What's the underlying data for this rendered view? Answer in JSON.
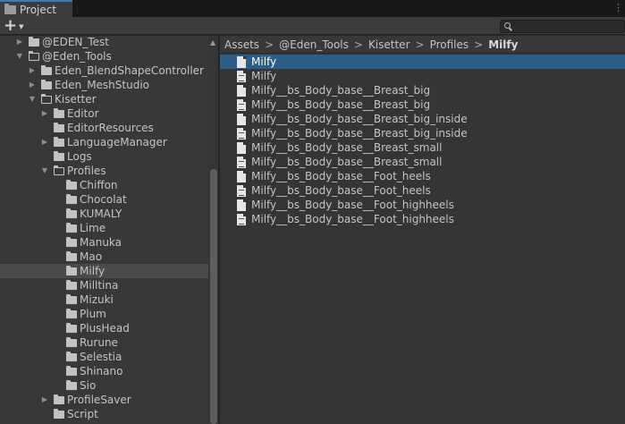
{
  "window": {
    "tab_label": "Project",
    "menu_glyph": "⋮"
  },
  "toolbar": {
    "add_glyph": "+",
    "add_caret": "▼"
  },
  "tree": {
    "rows": [
      {
        "label": "@EDEN_Test",
        "expanded": false,
        "has_children": true
      },
      {
        "label": "@Eden_Tools",
        "expanded": true,
        "has_children": true
      },
      {
        "label": "Eden_BlendShapeController",
        "expanded": false,
        "has_children": true
      },
      {
        "label": "Eden_MeshStudio",
        "expanded": false,
        "has_children": true
      },
      {
        "label": "Kisetter",
        "expanded": true,
        "has_children": true
      },
      {
        "label": "Editor",
        "expanded": false,
        "has_children": true
      },
      {
        "label": "EditorResources",
        "expanded": false,
        "has_children": false
      },
      {
        "label": "LanguageManager",
        "expanded": false,
        "has_children": true
      },
      {
        "label": "Logs",
        "expanded": false,
        "has_children": false
      },
      {
        "label": "Profiles",
        "expanded": true,
        "has_children": true
      },
      {
        "label": "Chiffon",
        "expanded": false,
        "has_children": false
      },
      {
        "label": "Chocolat",
        "expanded": false,
        "has_children": false
      },
      {
        "label": "KUMALY",
        "expanded": false,
        "has_children": false
      },
      {
        "label": "Lime",
        "expanded": false,
        "has_children": false
      },
      {
        "label": "Manuka",
        "expanded": false,
        "has_children": false
      },
      {
        "label": "Mao",
        "expanded": false,
        "has_children": false
      },
      {
        "label": "Milfy",
        "expanded": false,
        "has_children": false,
        "selected": true
      },
      {
        "label": "Milltina",
        "expanded": false,
        "has_children": false
      },
      {
        "label": "Mizuki",
        "expanded": false,
        "has_children": false
      },
      {
        "label": "Plum",
        "expanded": false,
        "has_children": false
      },
      {
        "label": "PlusHead",
        "expanded": false,
        "has_children": false
      },
      {
        "label": "Rurune",
        "expanded": false,
        "has_children": false
      },
      {
        "label": "Selestia",
        "expanded": false,
        "has_children": false
      },
      {
        "label": "Shinano",
        "expanded": false,
        "has_children": false
      },
      {
        "label": "Sio",
        "expanded": false,
        "has_children": false
      },
      {
        "label": "ProfileSaver",
        "expanded": false,
        "has_children": true
      },
      {
        "label": "Script",
        "expanded": false,
        "has_children": false
      }
    ]
  },
  "breadcrumb": {
    "items": [
      "Assets",
      "@Eden_Tools",
      "Kisetter",
      "Profiles",
      "Milfy"
    ],
    "separator": ">"
  },
  "files": [
    {
      "name": "Milfy",
      "icon": "file-icon",
      "selected": true
    },
    {
      "name": "Milfy",
      "icon": "text-file-icon"
    },
    {
      "name": "Milfy__bs_Body_base__Breast_big",
      "icon": "file-icon"
    },
    {
      "name": "Milfy__bs_Body_base__Breast_big",
      "icon": "text-file-icon"
    },
    {
      "name": "Milfy__bs_Body_base__Breast_big_inside",
      "icon": "file-icon"
    },
    {
      "name": "Milfy__bs_Body_base__Breast_big_inside",
      "icon": "text-file-icon"
    },
    {
      "name": "Milfy__bs_Body_base__Breast_small",
      "icon": "file-icon"
    },
    {
      "name": "Milfy__bs_Body_base__Breast_small",
      "icon": "text-file-icon"
    },
    {
      "name": "Milfy__bs_Body_base__Foot_heels",
      "icon": "file-icon"
    },
    {
      "name": "Milfy__bs_Body_base__Foot_heels",
      "icon": "text-file-icon"
    },
    {
      "name": "Milfy__bs_Body_base__Foot_highheels",
      "icon": "file-icon"
    },
    {
      "name": "Milfy__bs_Body_base__Foot_highheels",
      "icon": "text-file-icon"
    }
  ],
  "colors": {
    "selection_active": "#2c5d87",
    "selection_inactive": "#4a4a4a",
    "tab_accent": "#3a79bb"
  }
}
